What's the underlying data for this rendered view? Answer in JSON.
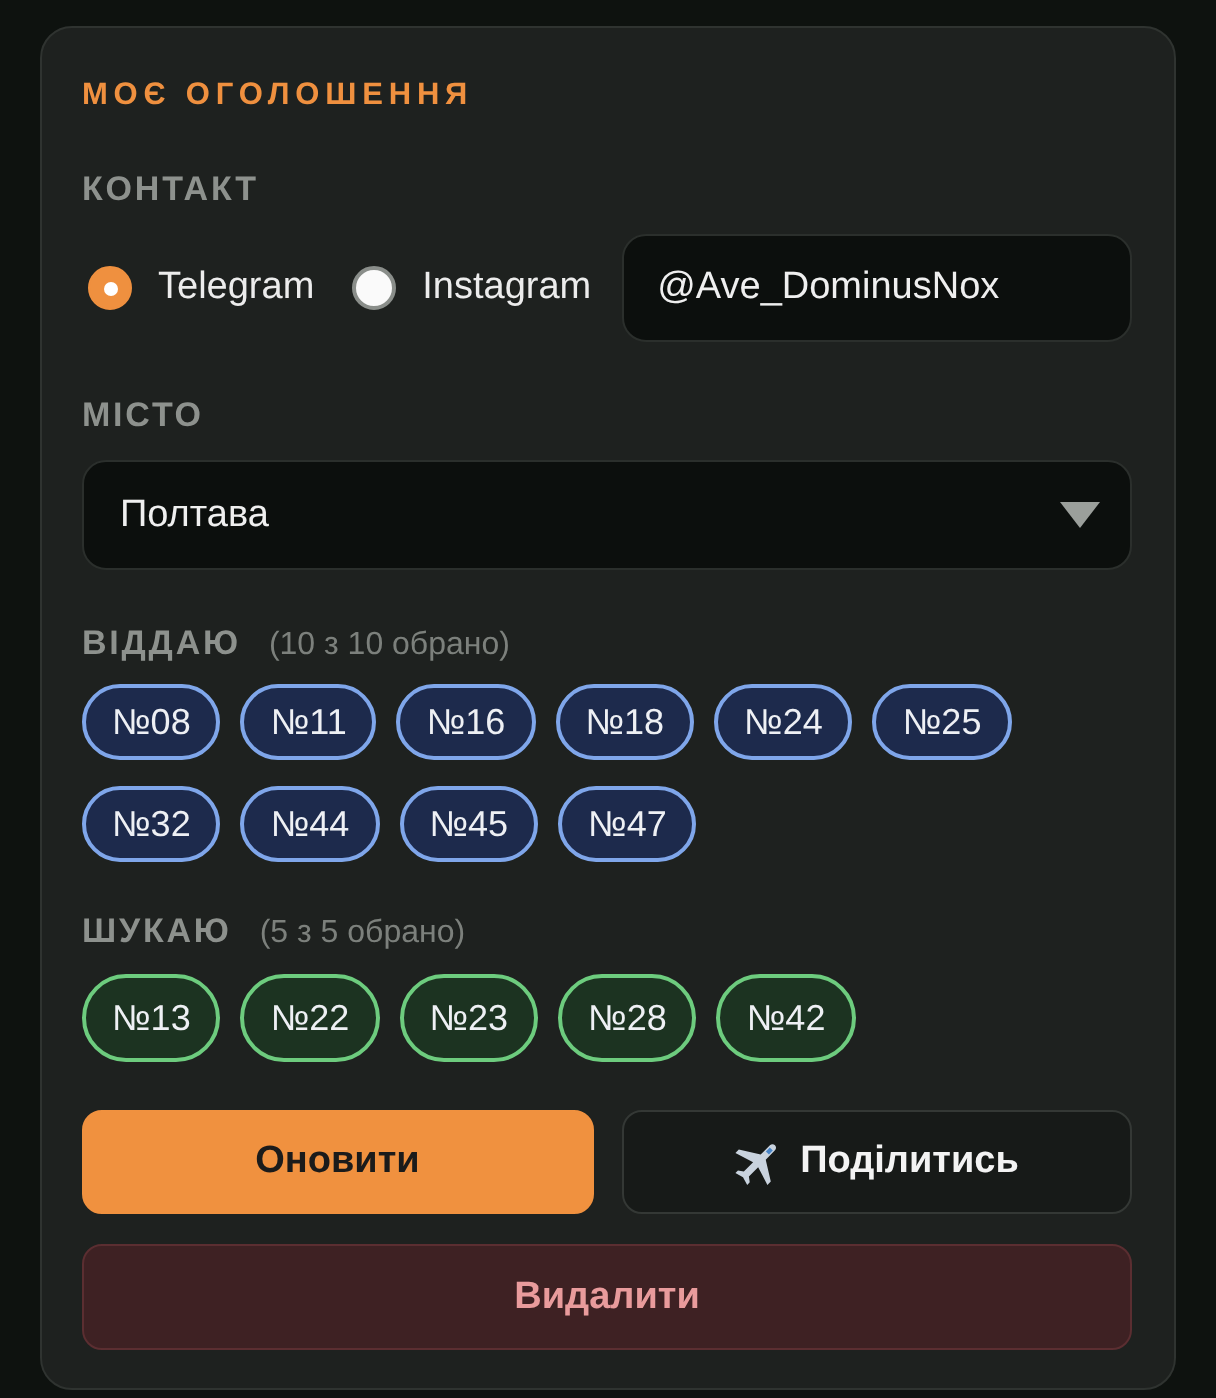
{
  "title": "МОЄ ОГОЛОШЕННЯ",
  "contact": {
    "label": "КОНТАКТ",
    "options": [
      {
        "label": "Telegram",
        "selected": true
      },
      {
        "label": "Instagram",
        "selected": false
      }
    ],
    "handle": {
      "value": "@Ave_DominusNox"
    }
  },
  "city": {
    "label": "МІСТО",
    "value": "Полтава"
  },
  "groups": [
    {
      "kind": "give",
      "label": "ВІДДАЮ",
      "count": "(10 з 10 обрано)",
      "chips": [
        {
          "label": "№08",
          "selected": true
        },
        {
          "label": "№11",
          "selected": true
        },
        {
          "label": "№16",
          "selected": true
        },
        {
          "label": "№18",
          "selected": true
        },
        {
          "label": "№24",
          "selected": true
        },
        {
          "label": "№25",
          "selected": true
        },
        {
          "label": "№32",
          "selected": true
        },
        {
          "label": "№44",
          "selected": true
        },
        {
          "label": "№45",
          "selected": true
        },
        {
          "label": "№47",
          "selected": true
        }
      ]
    },
    {
      "kind": "seek",
      "label": "ШУКАЮ",
      "count": "(5 з 5 обрано)",
      "chips": [
        {
          "label": "№13",
          "selected": true
        },
        {
          "label": "№22",
          "selected": true
        },
        {
          "label": "№23",
          "selected": true
        },
        {
          "label": "№28",
          "selected": true
        },
        {
          "label": "№42",
          "selected": true
        }
      ]
    }
  ],
  "actions": [
    {
      "kind": "primary",
      "label": "Оновити"
    },
    {
      "kind": "share",
      "label": "Поділитись"
    },
    {
      "kind": "danger",
      "label": "Видалити"
    }
  ]
}
